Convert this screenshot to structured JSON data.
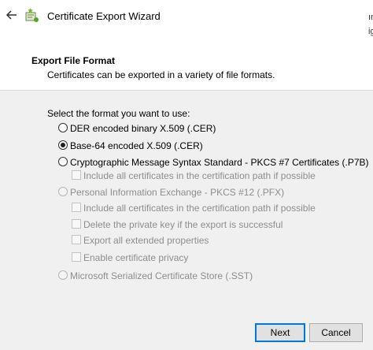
{
  "window": {
    "title": "Certificate Export Wizard",
    "edge_text": [
      "ın",
      "ig"
    ]
  },
  "header": {
    "title": "Export File Format",
    "subtitle": "Certificates can be exported in a variety of file formats."
  },
  "form": {
    "prompt": "Select the format you want to use:",
    "options": [
      {
        "label": "DER encoded binary X.509 (.CER)",
        "selected": false,
        "enabled": true
      },
      {
        "label": "Base-64 encoded X.509 (.CER)",
        "selected": true,
        "enabled": true
      },
      {
        "label": "Cryptographic Message Syntax Standard - PKCS #7 Certificates (.P7B)",
        "selected": false,
        "enabled": true
      },
      {
        "label": "Personal Information Exchange - PKCS #12 (.PFX)",
        "selected": false,
        "enabled": false
      },
      {
        "label": "Microsoft Serialized Certificate Store (.SST)",
        "selected": false,
        "enabled": false
      }
    ],
    "p7b_checkbox": {
      "label": "Include all certificates in the certification path if possible",
      "checked": false,
      "enabled": false
    },
    "pfx_checkboxes": [
      {
        "label": "Include all certificates in the certification path if possible",
        "checked": false,
        "enabled": false
      },
      {
        "label": "Delete the private key if the export is successful",
        "checked": false,
        "enabled": false
      },
      {
        "label": "Export all extended properties",
        "checked": false,
        "enabled": false
      },
      {
        "label": "Enable certificate privacy",
        "checked": false,
        "enabled": false
      }
    ]
  },
  "footer": {
    "next_label": "Next",
    "cancel_label": "Cancel"
  },
  "colors": {
    "accent": "#0078d7",
    "panel": "#f0f0f0"
  },
  "icons": [
    "back-arrow-icon",
    "certificate-wizard-icon"
  ]
}
